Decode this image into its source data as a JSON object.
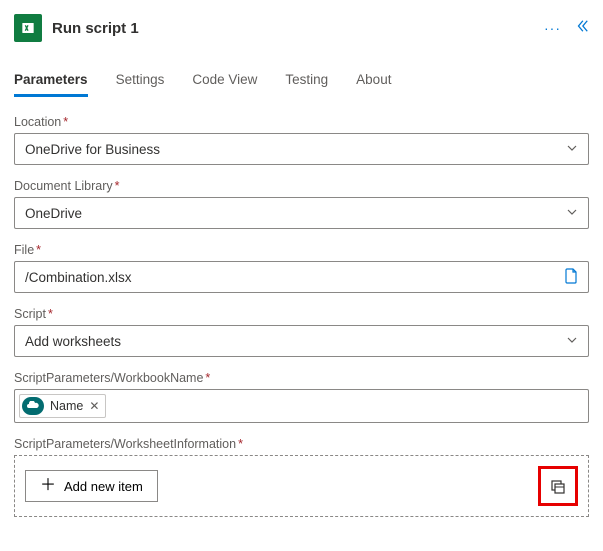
{
  "header": {
    "title": "Run script 1"
  },
  "tabs": {
    "parameters": "Parameters",
    "settings": "Settings",
    "codeview": "Code View",
    "testing": "Testing",
    "about": "About"
  },
  "fields": {
    "location": {
      "label": "Location",
      "value": "OneDrive for Business"
    },
    "library": {
      "label": "Document Library",
      "value": "OneDrive"
    },
    "file": {
      "label": "File",
      "value": "/Combination.xlsx"
    },
    "script": {
      "label": "Script",
      "value": "Add worksheets"
    },
    "workbookName": {
      "label": "ScriptParameters/WorkbookName",
      "tokenLabel": "Name"
    },
    "worksheetInfo": {
      "label": "ScriptParameters/WorksheetInformation",
      "addLabel": "Add new item"
    }
  },
  "requiredMark": "*"
}
